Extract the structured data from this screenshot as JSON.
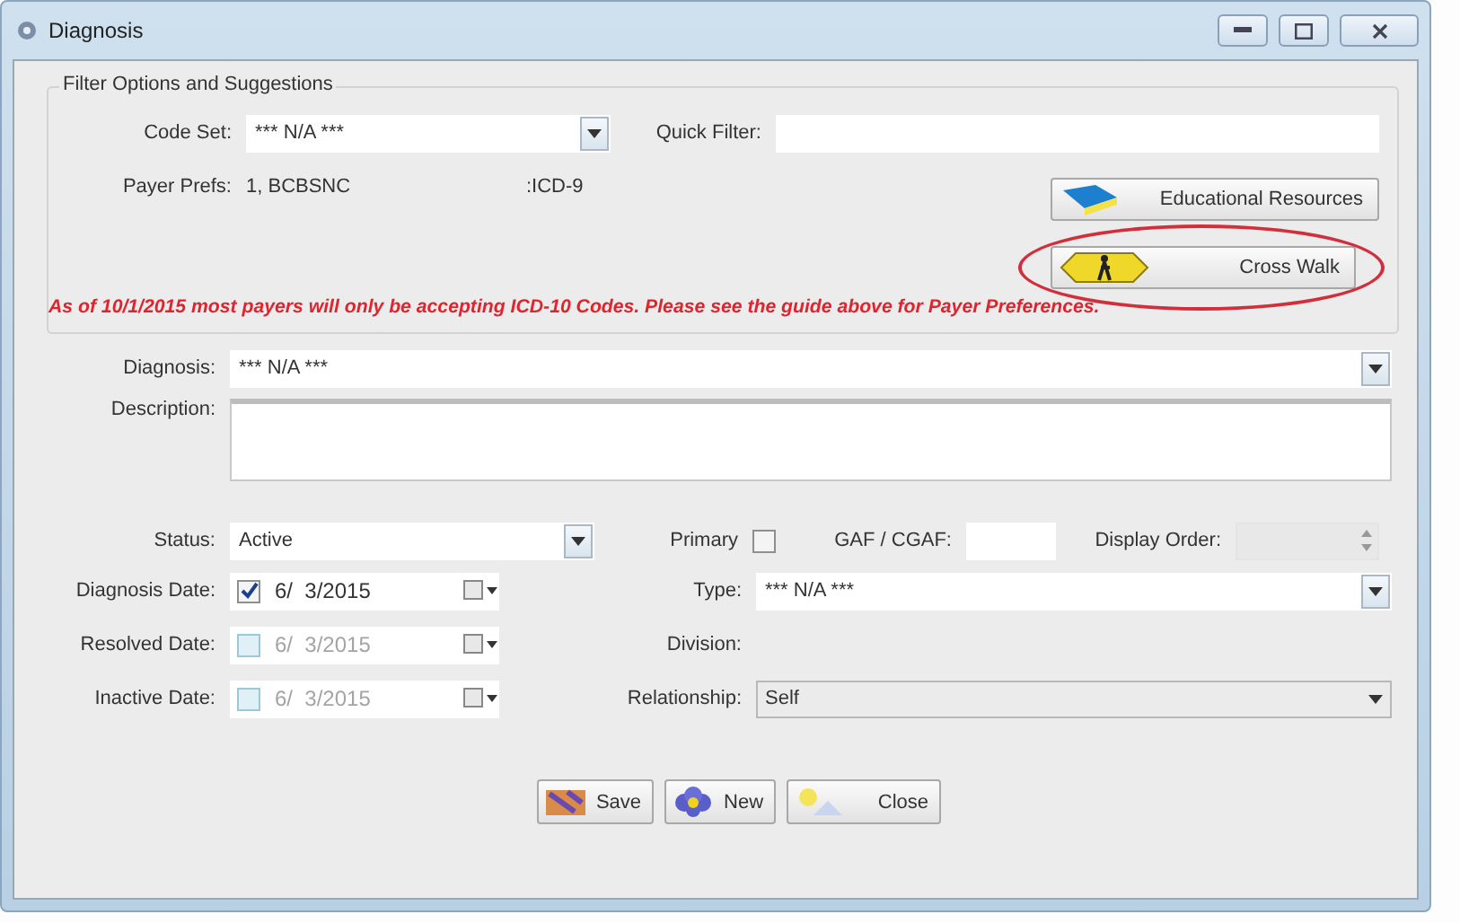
{
  "window": {
    "title": "Diagnosis"
  },
  "filter_group": {
    "title": "Filter Options and Suggestions",
    "code_set": {
      "label": "Code Set:",
      "value": "*** N/A ***"
    },
    "quick_filter": {
      "label": "Quick Filter:"
    },
    "payer_prefs": {
      "label": "Payer Prefs:",
      "payer": "1, BCBSNC",
      "code": ":ICD-9"
    },
    "buttons": [
      {
        "kind": "book",
        "label": "Educational Resources",
        "highlighted": false
      },
      {
        "kind": "crosswalk",
        "label": "Cross Walk",
        "highlighted": true
      }
    ],
    "notice": "As of 10/1/2015 most payers will only be accepting ICD-10 Codes. Please see the guide above for Payer Preferences."
  },
  "diagnosis": {
    "label": "Diagnosis:",
    "value": "*** N/A ***"
  },
  "description": {
    "label": "Description:"
  },
  "status": {
    "label": "Status:",
    "value": "Active"
  },
  "primary": {
    "label": "Primary",
    "checked": false
  },
  "gaf": {
    "label": "GAF / CGAF:"
  },
  "display_order": {
    "label": "Display Order:"
  },
  "dates": [
    {
      "label": "Diagnosis Date:",
      "value": "6/  3/2015",
      "checked": true
    },
    {
      "label": "Resolved Date:",
      "value": "6/  3/2015",
      "checked": false
    },
    {
      "label": "Inactive Date:",
      "value": "6/  3/2015",
      "checked": false
    }
  ],
  "type": {
    "label": "Type:",
    "value": "*** N/A ***"
  },
  "division": {
    "label": "Division:"
  },
  "relationship": {
    "label": "Relationship:",
    "value": "Self"
  },
  "actions": [
    {
      "kind": "save",
      "label": "Save"
    },
    {
      "kind": "new",
      "label": "New"
    },
    {
      "kind": "close",
      "label": "Close"
    }
  ]
}
